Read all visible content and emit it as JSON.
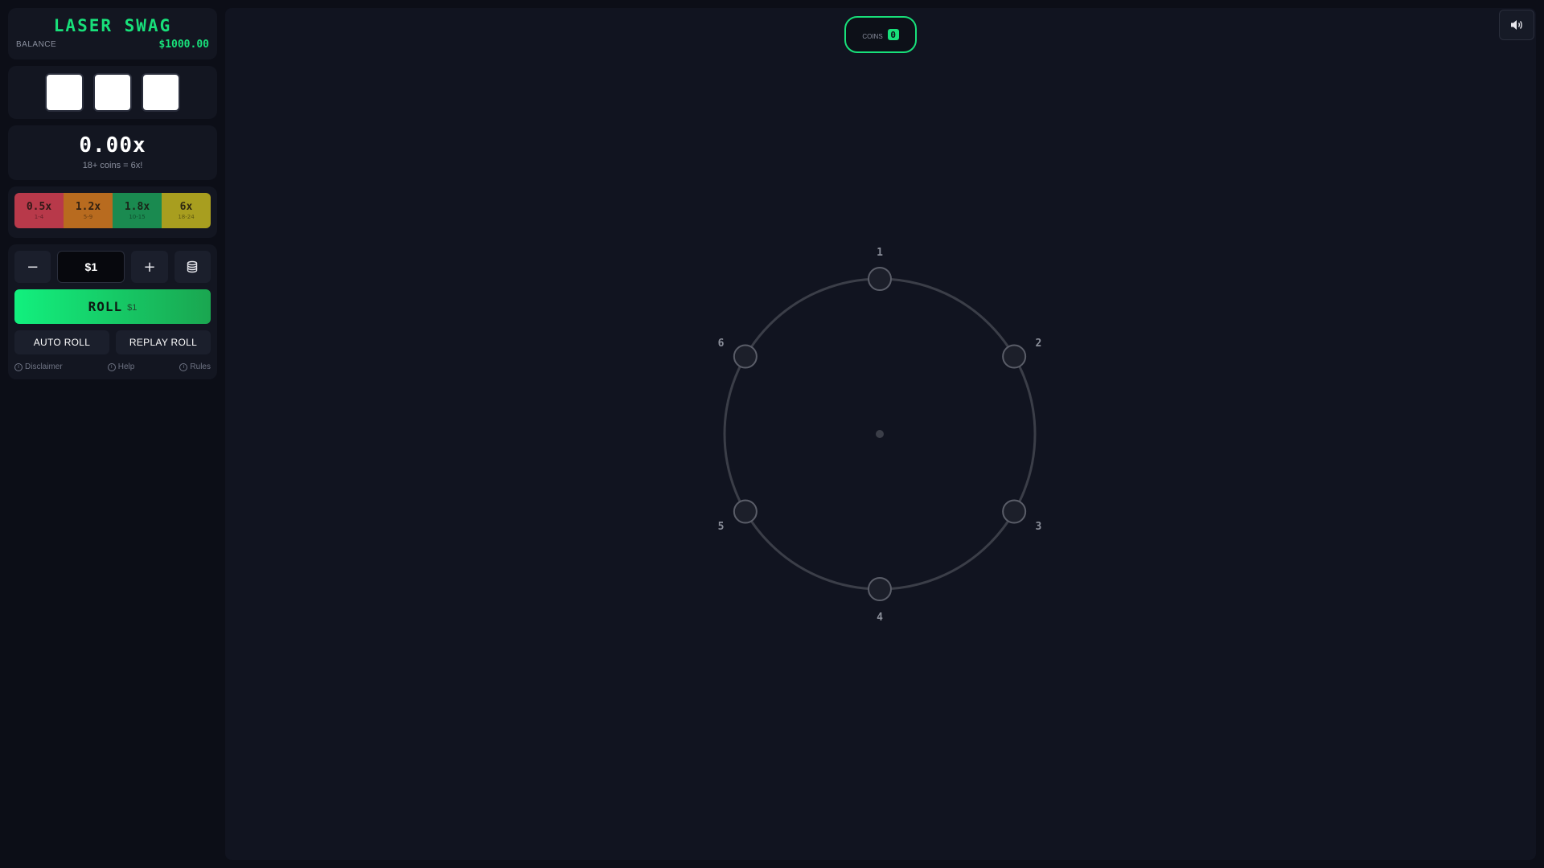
{
  "brand": {
    "title": "LASER SWAG",
    "balance_label": "BALANCE",
    "balance_value": "$1000.00"
  },
  "slots": [
    {
      "value": ""
    },
    {
      "value": ""
    },
    {
      "value": ""
    }
  ],
  "multiplier": {
    "value": "0.00x",
    "hint": "18+ coins = 6x!"
  },
  "tiers": [
    {
      "value": "0.5x",
      "range": "1-4",
      "color": "#b8394a"
    },
    {
      "value": "1.2x",
      "range": "5-9",
      "color": "#b86b1f"
    },
    {
      "value": "1.8x",
      "range": "10-15",
      "color": "#1a8a50"
    },
    {
      "value": "6x",
      "range": "18-24",
      "color": "#a89e1f"
    }
  ],
  "bet": {
    "decrease_label": "−",
    "amount": "$1",
    "increase_label": "+",
    "stack_icon": "coin-stack-icon"
  },
  "roll": {
    "label": "ROLL",
    "amount": "$1"
  },
  "secondary": {
    "auto_label": "AUTO ROLL",
    "replay_label": "REPLAY ROLL"
  },
  "links": [
    {
      "label": "Disclaimer",
      "icon": "info-icon"
    },
    {
      "label": "Help",
      "icon": "info-icon"
    },
    {
      "label": "Rules",
      "icon": "info-icon"
    }
  ],
  "coins": {
    "label": "COINS",
    "count": "0"
  },
  "sound": {
    "icon": "speaker-icon"
  },
  "wheel": {
    "nodes": [
      "1",
      "2",
      "3",
      "4",
      "5",
      "6"
    ]
  },
  "colors": {
    "accent": "#18e07a",
    "panel": "#131621",
    "stage": "#111420"
  }
}
